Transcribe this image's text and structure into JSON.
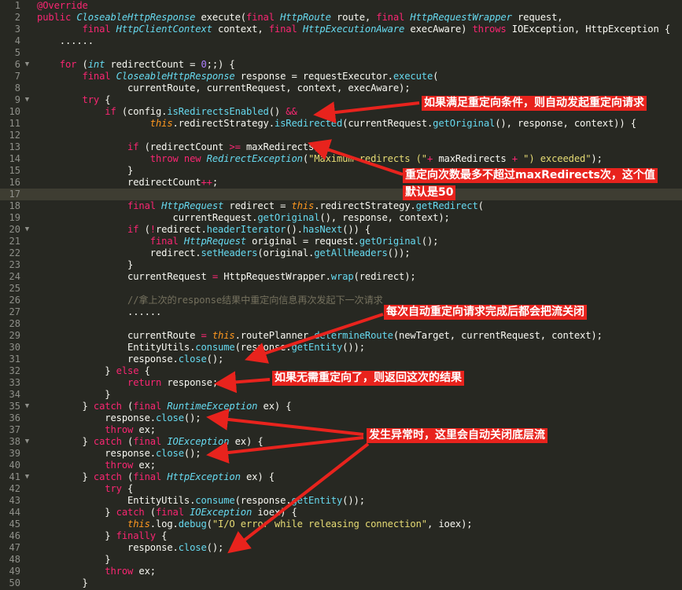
{
  "editor": {
    "highlighted_line": 17,
    "lines": [
      {
        "n": "1",
        "fold": "",
        "tokens": [
          [
            "an",
            "@Override"
          ]
        ]
      },
      {
        "n": "2",
        "fold": "",
        "tokens": [
          [
            "kw",
            "public "
          ],
          [
            "ty",
            "CloseableHttpResponse"
          ],
          [
            "pl",
            " execute("
          ],
          [
            "kw",
            "final "
          ],
          [
            "ty",
            "HttpRoute"
          ],
          [
            "pl",
            " route, "
          ],
          [
            "kw",
            "final "
          ],
          [
            "ty",
            "HttpRequestWrapper"
          ],
          [
            "pl",
            " request,"
          ]
        ]
      },
      {
        "n": "3",
        "fold": "",
        "tokens": [
          [
            "pl",
            "        "
          ],
          [
            "kw",
            "final "
          ],
          [
            "ty",
            "HttpClientContext"
          ],
          [
            "pl",
            " context, "
          ],
          [
            "kw",
            "final "
          ],
          [
            "ty",
            "HttpExecutionAware"
          ],
          [
            "pl",
            " execAware) "
          ],
          [
            "kw",
            "throws "
          ],
          [
            "pl",
            "IOException, HttpException {"
          ]
        ]
      },
      {
        "n": "4",
        "fold": "",
        "tokens": [
          [
            "pl",
            "    ......"
          ]
        ]
      },
      {
        "n": "5",
        "fold": "",
        "tokens": []
      },
      {
        "n": "6",
        "fold": "▼",
        "tokens": [
          [
            "pl",
            "    "
          ],
          [
            "kw",
            "for "
          ],
          [
            "pl",
            "("
          ],
          [
            "ty",
            "int"
          ],
          [
            "pl",
            " redirectCount = "
          ],
          [
            "nu",
            "0"
          ],
          [
            "pl",
            ";;) {"
          ]
        ]
      },
      {
        "n": "7",
        "fold": "",
        "tokens": [
          [
            "pl",
            "        "
          ],
          [
            "kw",
            "final "
          ],
          [
            "ty",
            "CloseableHttpResponse"
          ],
          [
            "pl",
            " response = requestExecutor."
          ],
          [
            "fn",
            "execute"
          ],
          [
            "pl",
            "("
          ]
        ]
      },
      {
        "n": "8",
        "fold": "",
        "tokens": [
          [
            "pl",
            "                currentRoute, currentRequest, context, execAware);"
          ]
        ]
      },
      {
        "n": "9",
        "fold": "▼",
        "tokens": [
          [
            "pl",
            "        "
          ],
          [
            "kw",
            "try "
          ],
          [
            "pl",
            "{"
          ]
        ]
      },
      {
        "n": "10",
        "fold": "",
        "tokens": [
          [
            "pl",
            "            "
          ],
          [
            "kw",
            "if "
          ],
          [
            "pl",
            "(config."
          ],
          [
            "fn",
            "isRedirectsEnabled"
          ],
          [
            "pl",
            "() "
          ],
          [
            "kw",
            "&&"
          ]
        ]
      },
      {
        "n": "11",
        "fold": "",
        "tokens": [
          [
            "pl",
            "                    "
          ],
          [
            "th",
            "this"
          ],
          [
            "pl",
            ".redirectStrategy."
          ],
          [
            "fn",
            "isRedirected"
          ],
          [
            "pl",
            "(currentRequest."
          ],
          [
            "fn",
            "getOriginal"
          ],
          [
            "pl",
            "(), response, context)) {"
          ]
        ]
      },
      {
        "n": "12",
        "fold": "",
        "tokens": []
      },
      {
        "n": "13",
        "fold": "",
        "tokens": [
          [
            "pl",
            "                "
          ],
          [
            "kw",
            "if "
          ],
          [
            "pl",
            "(redirectCount "
          ],
          [
            "kw",
            ">="
          ],
          [
            "pl",
            " maxRedirects) {"
          ]
        ]
      },
      {
        "n": "14",
        "fold": "",
        "tokens": [
          [
            "pl",
            "                    "
          ],
          [
            "kw",
            "throw new "
          ],
          [
            "ty",
            "RedirectException"
          ],
          [
            "pl",
            "("
          ],
          [
            "st",
            "\"Maximum redirects (\""
          ],
          [
            "kw",
            "+ "
          ],
          [
            "pl",
            "maxRedirects "
          ],
          [
            "kw",
            "+ "
          ],
          [
            "st",
            "\") exceeded\""
          ],
          [
            "pl",
            ");"
          ]
        ]
      },
      {
        "n": "15",
        "fold": "",
        "tokens": [
          [
            "pl",
            "                }"
          ]
        ]
      },
      {
        "n": "16",
        "fold": "",
        "tokens": [
          [
            "pl",
            "                redirectCount"
          ],
          [
            "kw",
            "++"
          ],
          [
            "pl",
            ";"
          ]
        ]
      },
      {
        "n": "17",
        "fold": "",
        "tokens": []
      },
      {
        "n": "18",
        "fold": "",
        "tokens": [
          [
            "pl",
            "                "
          ],
          [
            "kw",
            "final "
          ],
          [
            "ty",
            "HttpRequest"
          ],
          [
            "pl",
            " redirect = "
          ],
          [
            "th",
            "this"
          ],
          [
            "pl",
            ".redirectStrategy."
          ],
          [
            "fn",
            "getRedirect"
          ],
          [
            "pl",
            "("
          ]
        ]
      },
      {
        "n": "19",
        "fold": "",
        "tokens": [
          [
            "pl",
            "                        currentRequest."
          ],
          [
            "fn",
            "getOriginal"
          ],
          [
            "pl",
            "(), response, context);"
          ]
        ]
      },
      {
        "n": "20",
        "fold": "▼",
        "tokens": [
          [
            "pl",
            "                "
          ],
          [
            "kw",
            "if "
          ],
          [
            "pl",
            "("
          ],
          [
            "kw",
            "!"
          ],
          [
            "pl",
            "redirect."
          ],
          [
            "fn",
            "headerIterator"
          ],
          [
            "pl",
            "()."
          ],
          [
            "fn",
            "hasNext"
          ],
          [
            "pl",
            "()) {"
          ]
        ]
      },
      {
        "n": "21",
        "fold": "",
        "tokens": [
          [
            "pl",
            "                    "
          ],
          [
            "kw",
            "final "
          ],
          [
            "ty",
            "HttpRequest"
          ],
          [
            "pl",
            " original = request."
          ],
          [
            "fn",
            "getOriginal"
          ],
          [
            "pl",
            "();"
          ]
        ]
      },
      {
        "n": "22",
        "fold": "",
        "tokens": [
          [
            "pl",
            "                    redirect."
          ],
          [
            "fn",
            "setHeaders"
          ],
          [
            "pl",
            "(original."
          ],
          [
            "fn",
            "getAllHeaders"
          ],
          [
            "pl",
            "());"
          ]
        ]
      },
      {
        "n": "23",
        "fold": "",
        "tokens": [
          [
            "pl",
            "                }"
          ]
        ]
      },
      {
        "n": "24",
        "fold": "",
        "tokens": [
          [
            "pl",
            "                currentRequest "
          ],
          [
            "kw",
            "= "
          ],
          [
            "pl",
            "HttpRequestWrapper."
          ],
          [
            "fn",
            "wrap"
          ],
          [
            "pl",
            "(redirect);"
          ]
        ]
      },
      {
        "n": "25",
        "fold": "",
        "tokens": []
      },
      {
        "n": "26",
        "fold": "",
        "tokens": [
          [
            "pl",
            "                "
          ],
          [
            "cm",
            "//拿上次的response结果中重定向信息再次发起下一次请求"
          ]
        ]
      },
      {
        "n": "27",
        "fold": "",
        "tokens": [
          [
            "pl",
            "                ......"
          ]
        ]
      },
      {
        "n": "28",
        "fold": "",
        "tokens": []
      },
      {
        "n": "29",
        "fold": "",
        "tokens": [
          [
            "pl",
            "                currentRoute "
          ],
          [
            "kw",
            "= "
          ],
          [
            "th",
            "this"
          ],
          [
            "pl",
            ".routePlanner."
          ],
          [
            "fn",
            "determineRoute"
          ],
          [
            "pl",
            "(newTarget, currentRequest, context);"
          ]
        ]
      },
      {
        "n": "30",
        "fold": "",
        "tokens": [
          [
            "pl",
            "                EntityUtils."
          ],
          [
            "fn",
            "consume"
          ],
          [
            "pl",
            "(response."
          ],
          [
            "fn",
            "getEntity"
          ],
          [
            "pl",
            "());"
          ]
        ]
      },
      {
        "n": "31",
        "fold": "",
        "tokens": [
          [
            "pl",
            "                response."
          ],
          [
            "fn",
            "close"
          ],
          [
            "pl",
            "();"
          ]
        ]
      },
      {
        "n": "32",
        "fold": "",
        "tokens": [
          [
            "pl",
            "            } "
          ],
          [
            "kw",
            "else "
          ],
          [
            "pl",
            "{"
          ]
        ]
      },
      {
        "n": "33",
        "fold": "",
        "tokens": [
          [
            "pl",
            "                "
          ],
          [
            "kw",
            "return "
          ],
          [
            "pl",
            "response;"
          ]
        ]
      },
      {
        "n": "34",
        "fold": "",
        "tokens": [
          [
            "pl",
            "            }"
          ]
        ]
      },
      {
        "n": "35",
        "fold": "▼",
        "tokens": [
          [
            "pl",
            "        } "
          ],
          [
            "kw",
            "catch "
          ],
          [
            "pl",
            "("
          ],
          [
            "kw",
            "final "
          ],
          [
            "ty",
            "RuntimeException"
          ],
          [
            "pl",
            " ex) {"
          ]
        ]
      },
      {
        "n": "36",
        "fold": "",
        "tokens": [
          [
            "pl",
            "            response."
          ],
          [
            "fn",
            "close"
          ],
          [
            "pl",
            "();"
          ]
        ]
      },
      {
        "n": "37",
        "fold": "",
        "tokens": [
          [
            "pl",
            "            "
          ],
          [
            "kw",
            "throw "
          ],
          [
            "pl",
            "ex;"
          ]
        ]
      },
      {
        "n": "38",
        "fold": "▼",
        "tokens": [
          [
            "pl",
            "        } "
          ],
          [
            "kw",
            "catch "
          ],
          [
            "pl",
            "("
          ],
          [
            "kw",
            "final "
          ],
          [
            "ty",
            "IOException"
          ],
          [
            "pl",
            " ex) {"
          ]
        ]
      },
      {
        "n": "39",
        "fold": "",
        "tokens": [
          [
            "pl",
            "            response."
          ],
          [
            "fn",
            "close"
          ],
          [
            "pl",
            "();"
          ]
        ]
      },
      {
        "n": "40",
        "fold": "",
        "tokens": [
          [
            "pl",
            "            "
          ],
          [
            "kw",
            "throw "
          ],
          [
            "pl",
            "ex;"
          ]
        ]
      },
      {
        "n": "41",
        "fold": "▼",
        "tokens": [
          [
            "pl",
            "        } "
          ],
          [
            "kw",
            "catch "
          ],
          [
            "pl",
            "("
          ],
          [
            "kw",
            "final "
          ],
          [
            "ty",
            "HttpException"
          ],
          [
            "pl",
            " ex) {"
          ]
        ]
      },
      {
        "n": "42",
        "fold": "",
        "tokens": [
          [
            "pl",
            "            "
          ],
          [
            "kw",
            "try "
          ],
          [
            "pl",
            "{"
          ]
        ]
      },
      {
        "n": "43",
        "fold": "",
        "tokens": [
          [
            "pl",
            "                EntityUtils."
          ],
          [
            "fn",
            "consume"
          ],
          [
            "pl",
            "(response."
          ],
          [
            "fn",
            "getEntity"
          ],
          [
            "pl",
            "());"
          ]
        ]
      },
      {
        "n": "44",
        "fold": "",
        "tokens": [
          [
            "pl",
            "            } "
          ],
          [
            "kw",
            "catch "
          ],
          [
            "pl",
            "("
          ],
          [
            "kw",
            "final "
          ],
          [
            "ty",
            "IOException"
          ],
          [
            "pl",
            " ioex) {"
          ]
        ]
      },
      {
        "n": "45",
        "fold": "",
        "tokens": [
          [
            "pl",
            "                "
          ],
          [
            "th",
            "this"
          ],
          [
            "pl",
            ".log."
          ],
          [
            "fn",
            "debug"
          ],
          [
            "pl",
            "("
          ],
          [
            "st",
            "\"I/O error while releasing connection\""
          ],
          [
            "pl",
            ", ioex);"
          ]
        ]
      },
      {
        "n": "46",
        "fold": "",
        "tokens": [
          [
            "pl",
            "            } "
          ],
          [
            "kw",
            "finally "
          ],
          [
            "pl",
            "{"
          ]
        ]
      },
      {
        "n": "47",
        "fold": "",
        "tokens": [
          [
            "pl",
            "                response."
          ],
          [
            "fn",
            "close"
          ],
          [
            "pl",
            "();"
          ]
        ]
      },
      {
        "n": "48",
        "fold": "",
        "tokens": [
          [
            "pl",
            "            }"
          ]
        ]
      },
      {
        "n": "49",
        "fold": "",
        "tokens": [
          [
            "pl",
            "            "
          ],
          [
            "kw",
            "throw "
          ],
          [
            "pl",
            "ex;"
          ]
        ]
      },
      {
        "n": "50",
        "fold": "",
        "tokens": [
          [
            "pl",
            "        }"
          ]
        ]
      }
    ]
  },
  "annotations": {
    "color": "#e8231d",
    "note1": "如果满足重定向条件，则自动发起重定向请求",
    "note2_line1": "重定向次数最多不超过maxRedirects次，这个值",
    "note2_line2": "默认是50",
    "note3": "每次自动重定向请求完成后都会把流关闭",
    "note4": "如果无需重定向了，则返回这次的结果",
    "note5": "发生异常时，这里会自动关闭底层流"
  }
}
